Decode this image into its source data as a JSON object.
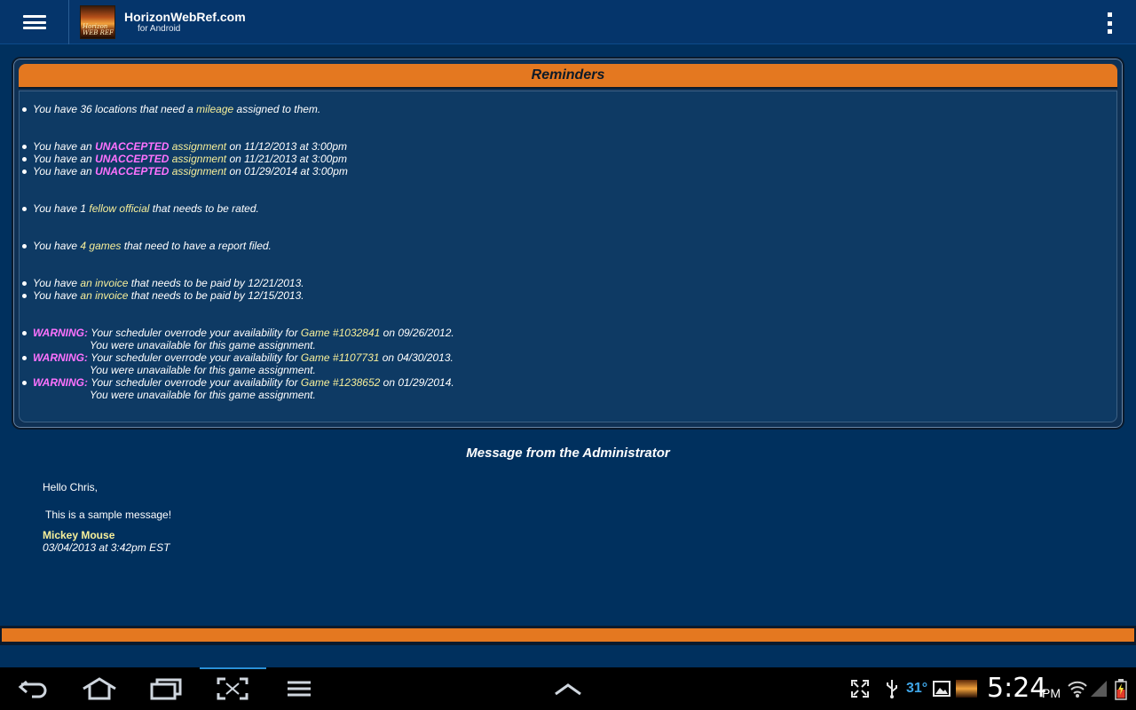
{
  "app": {
    "title": "HorizonWebRef.com",
    "subtitle": "for Android",
    "logo_text_1": "Horizon",
    "logo_text_2": "WEB REF"
  },
  "reminders": {
    "title": "Reminders",
    "mileage": {
      "pre": "You have 36 locations that need a ",
      "link": "mileage",
      "post": " assigned to them."
    },
    "assignments": [
      {
        "pre": "You have an ",
        "status": "UNACCEPTED",
        "link": "assignment",
        "post": " on 11/12/2013 at 3:00pm"
      },
      {
        "pre": "You have an ",
        "status": "UNACCEPTED",
        "link": "assignment",
        "post": " on 11/21/2013 at 3:00pm"
      },
      {
        "pre": "You have an ",
        "status": "UNACCEPTED",
        "link": "assignment",
        "post": " on 01/29/2014 at 3:00pm"
      }
    ],
    "fellow": {
      "pre": "You have 1 ",
      "link": "fellow official",
      "post": " that needs to be rated."
    },
    "games": {
      "pre": "You have ",
      "link": "4 games",
      "post": " that need to have a report filed."
    },
    "invoices": [
      {
        "pre": "You have ",
        "link": "an invoice",
        "post": " that needs to be paid by 12/21/2013."
      },
      {
        "pre": "You have ",
        "link": "an invoice",
        "post": " that needs to be paid by 12/15/2013."
      }
    ],
    "warnings": [
      {
        "label": "WARNING:",
        "pre": " Your scheduler overrode your availability for ",
        "link": "Game #1032841",
        "post": " on 09/26/2012.",
        "note": "You were unavailable for this game assignment."
      },
      {
        "label": "WARNING:",
        "pre": " Your scheduler overrode your availability for ",
        "link": "Game #1107731",
        "post": " on 04/30/2013.",
        "note": "You were unavailable for this game assignment."
      },
      {
        "label": "WARNING:",
        "pre": " Your scheduler overrode your availability for ",
        "link": "Game #1238652",
        "post": " on 01/29/2014.",
        "note": "You were unavailable for this game assignment."
      }
    ]
  },
  "admin_message": {
    "title": "Message from the Administrator",
    "greeting": "Hello Chris,",
    "body": "This is a sample message!",
    "author": "Mickey Mouse",
    "date": "03/04/2013 at 3:42pm EST"
  },
  "status_bar": {
    "temperature": "31°",
    "time": "5:24",
    "ampm": "PM"
  },
  "colors": {
    "background": "#00305e",
    "accent_orange": "#e47820",
    "link_yellow": "#f7ef9a",
    "status_magenta": "#ff72ff",
    "temp_blue": "#3fa6e8"
  },
  "icons": [
    "menu-icon",
    "overflow-menu-icon",
    "back-icon",
    "home-icon",
    "recent-apps-icon",
    "screenshot-icon",
    "menu-lines-icon",
    "chevron-up-icon",
    "fullscreen-icon",
    "usb-icon",
    "gallery-icon",
    "wifi-icon",
    "signal-icon",
    "battery-icon"
  ]
}
